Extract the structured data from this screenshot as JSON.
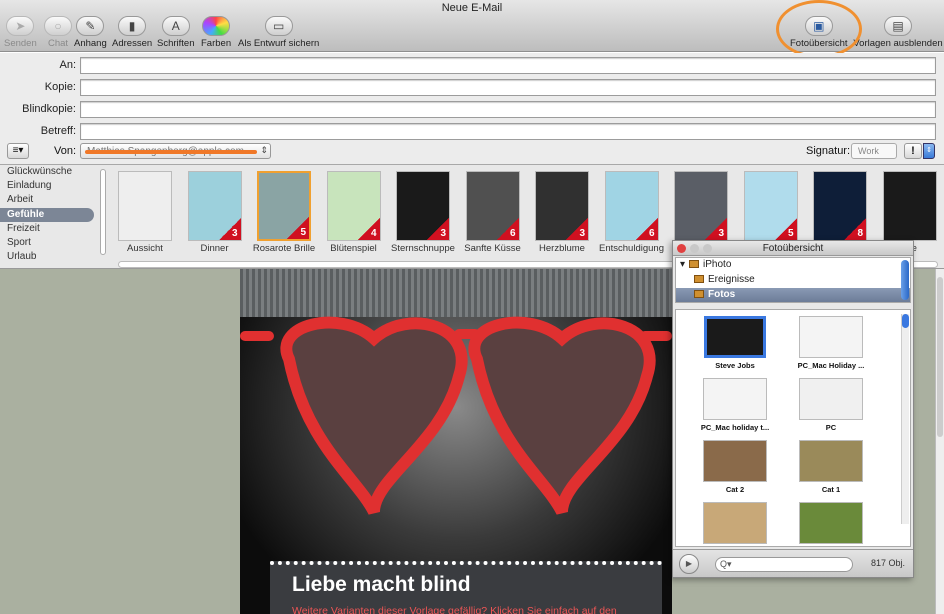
{
  "window": {
    "title": "Neue E-Mail"
  },
  "toolbar": {
    "senden": "Senden",
    "chat": "Chat",
    "anhang": "Anhang",
    "adressen": "Adressen",
    "schriften": "Schriften",
    "farben": "Farben",
    "entwurf": "Als Entwurf sichern",
    "fotouebersicht": "Fotoübersicht",
    "vorlagen": "Vorlagen ausblenden"
  },
  "header": {
    "an": "An:",
    "kopie": "Kopie:",
    "blindkopie": "Blindkopie:",
    "betreff": "Betreff:",
    "von": "Von:",
    "von_value": "Matthias Spangenberg@apple.com",
    "signatur": "Signatur:",
    "signatur_value": "Work",
    "priority": "!"
  },
  "stationery": {
    "categories": [
      "Glückwünsche",
      "Einladung",
      "Arbeit",
      "Gefühle",
      "Freizeit",
      "Sport",
      "Urlaub"
    ],
    "selected_category": "Gefühle",
    "templates": [
      {
        "name": "Aussicht",
        "badge": ""
      },
      {
        "name": "Dinner",
        "badge": "3"
      },
      {
        "name": "Rosarote Brille",
        "badge": "5"
      },
      {
        "name": "Blütenspiel",
        "badge": "4"
      },
      {
        "name": "Sternschnuppe",
        "badge": "3"
      },
      {
        "name": "Sanfte Küsse",
        "badge": "6"
      },
      {
        "name": "Herzblume",
        "badge": "3"
      },
      {
        "name": "Entschuldigung",
        "badge": "6"
      },
      {
        "name": "",
        "badge": "3"
      },
      {
        "name": "",
        "badge": "5"
      },
      {
        "name": "",
        "badge": "8"
      },
      {
        "name": "cke",
        "badge": ""
      }
    ],
    "colors": [
      "#eeeeee",
      "#9cd0dc",
      "#8aa4a4",
      "#c8e4bc",
      "#1a1a1a",
      "#505050",
      "#303030",
      "#a0d4e4",
      "#5a5e66",
      "#b0dcec",
      "#0e1e38",
      "#1a1a1a"
    ]
  },
  "message": {
    "title": "Liebe macht blind",
    "subtitle": "Weitere Varianten dieser Vorlage gefällig? Klicken Sie einfach auf den"
  },
  "iphoto_panel": {
    "title": "Fotoübersicht",
    "sources": [
      "iPhoto",
      "Ereignisse",
      "Fotos"
    ],
    "selected_source": "Fotos",
    "photos": [
      {
        "caption": "Steve Jobs",
        "color": "#1a1a1a"
      },
      {
        "caption": "PC_Mac Holiday ...",
        "color": "#f4f4f4"
      },
      {
        "caption": "PC_Mac holiday t...",
        "color": "#f4f4f4"
      },
      {
        "caption": "PC",
        "color": "#f0f0f0"
      },
      {
        "caption": "Cat 2",
        "color": "#8a6a4a"
      },
      {
        "caption": "Cat 1",
        "color": "#9a8a5a"
      },
      {
        "caption": "",
        "color": "#c8a878"
      },
      {
        "caption": "",
        "color": "#6a8a3a"
      }
    ],
    "search_placeholder": "Q▾",
    "count": "817 Obj."
  }
}
